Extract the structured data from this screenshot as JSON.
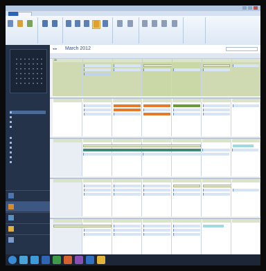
{
  "window": {
    "title": ""
  },
  "ribbon": {
    "tabs": [
      {
        "label": ""
      },
      {
        "label": ""
      },
      {
        "label": ""
      },
      {
        "label": ""
      },
      {
        "label": ""
      },
      {
        "label": ""
      }
    ],
    "groups": [
      {
        "label": ""
      },
      {
        "label": ""
      },
      {
        "label": ""
      },
      {
        "label": ""
      },
      {
        "label": ""
      },
      {
        "label": ""
      },
      {
        "label": ""
      }
    ],
    "buttons": [
      {
        "label": "",
        "icon": "new-appointment-icon",
        "color": "#6c8cc2"
      },
      {
        "label": "",
        "icon": "new-meeting-icon",
        "color": "#d7a13a"
      },
      {
        "label": "",
        "icon": "new-items-icon",
        "color": "#7aa35a"
      },
      {
        "label": "",
        "icon": "today-icon",
        "color": "#4f78b3"
      },
      {
        "label": "",
        "icon": "next-days-icon",
        "color": "#4f78b3"
      },
      {
        "label": "",
        "icon": "day-view-icon",
        "color": "#5c7fb6"
      },
      {
        "label": "",
        "icon": "work-week-icon",
        "color": "#5c7fb6"
      },
      {
        "label": "",
        "icon": "week-view-icon",
        "color": "#5c7fb6"
      },
      {
        "label": "",
        "icon": "month-view-icon",
        "color": "#e0a030"
      },
      {
        "label": "",
        "icon": "schedule-view-icon",
        "color": "#5c7fb6"
      },
      {
        "label": "",
        "icon": "open-calendar-icon",
        "color": "#8b9db8"
      },
      {
        "label": "",
        "icon": "calendar-groups-icon",
        "color": "#8b9db8"
      },
      {
        "label": "",
        "icon": "email-calendar-icon",
        "color": "#8b9db8"
      },
      {
        "label": "",
        "icon": "share-calendar-icon",
        "color": "#8b9db8"
      },
      {
        "label": "",
        "icon": "publish-online-icon",
        "color": "#8b9db8"
      },
      {
        "label": "",
        "icon": "calendar-permissions-icon",
        "color": "#8b9db8"
      }
    ]
  },
  "sidebar": {
    "mini_calendar": {
      "month": ""
    },
    "items": [
      {
        "label": ""
      },
      {
        "label": ""
      },
      {
        "label": ""
      },
      {
        "label": ""
      },
      {
        "label": ""
      },
      {
        "label": ""
      },
      {
        "label": ""
      },
      {
        "label": ""
      },
      {
        "label": ""
      },
      {
        "label": ""
      },
      {
        "label": ""
      },
      {
        "label": ""
      }
    ],
    "sections": [
      {
        "label": ""
      },
      {
        "label": ""
      }
    ],
    "big_nav": [
      {
        "label": "",
        "icon": "mail-icon",
        "color": "#4c74b0"
      },
      {
        "label": "",
        "icon": "calendar-icon",
        "color": "#d78b2f"
      },
      {
        "label": "",
        "icon": "contacts-icon",
        "color": "#5a8fc4"
      },
      {
        "label": "",
        "icon": "tasks-icon",
        "color": "#e0b040"
      },
      {
        "label": "",
        "icon": "notes-icon",
        "color": "#7a9bc9"
      }
    ]
  },
  "calendar": {
    "month_title": "March 2012",
    "search_placeholder": "",
    "days_of_week": [
      "",
      "",
      "",
      "",
      "",
      "",
      ""
    ],
    "weeks": [
      {
        "days": [
          "26",
          "",
          "",
          "",
          "",
          "",
          ""
        ]
      },
      {
        "days": [
          "",
          "",
          "",
          "",
          "",
          "",
          ""
        ]
      },
      {
        "days": [
          "",
          "",
          "",
          "",
          "",
          "",
          ""
        ]
      },
      {
        "days": [
          "",
          "",
          "",
          "",
          "",
          "",
          ""
        ]
      },
      {
        "days": [
          "",
          "",
          "",
          "",
          "",
          "",
          ""
        ]
      }
    ],
    "events": [
      {
        "label": ""
      },
      {
        "label": ""
      },
      {
        "label": ""
      },
      {
        "label": ""
      },
      {
        "label": ""
      },
      {
        "label": ""
      },
      {
        "label": ""
      },
      {
        "label": ""
      },
      {
        "label": ""
      },
      {
        "label": ""
      }
    ]
  },
  "status": {
    "left": "",
    "right": ""
  },
  "taskbar": {
    "apps": [
      {
        "icon": "start-icon",
        "color": "#3a8ad6"
      },
      {
        "icon": "explorer-icon",
        "color": "#4aa3d8"
      },
      {
        "icon": "browser-icon",
        "color": "#3f9ad9"
      },
      {
        "icon": "word-icon",
        "color": "#2f66b3"
      },
      {
        "icon": "excel-icon",
        "color": "#3f9a4a"
      },
      {
        "icon": "powerpoint-icon",
        "color": "#d7602f"
      },
      {
        "icon": "onenote-icon",
        "color": "#8a4fb3"
      },
      {
        "icon": "outlook-icon",
        "color": "#3070c0"
      },
      {
        "icon": "folder-icon",
        "color": "#e2b43a"
      }
    ],
    "clock": ""
  }
}
